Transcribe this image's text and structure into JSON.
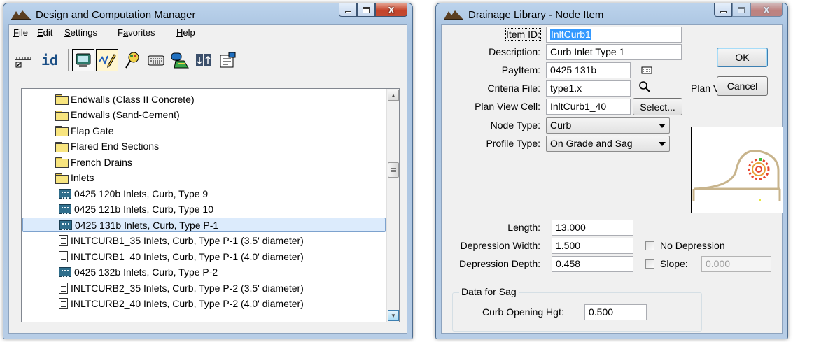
{
  "dcm": {
    "title": "Design and Computation Manager",
    "menu": [
      "File",
      "Edit",
      "Settings",
      "Favorites",
      "Help"
    ],
    "menu_accel": [
      "F",
      "E",
      "S",
      "a",
      "H"
    ],
    "toolbar_label": "id",
    "tree": [
      {
        "type": "folder",
        "label": "Endwalls (Class II Concrete)",
        "indent": 1
      },
      {
        "type": "folder",
        "label": "Endwalls (Sand-Cement)",
        "indent": 1
      },
      {
        "type": "folder",
        "label": "Flap Gate",
        "indent": 1
      },
      {
        "type": "folder",
        "label": "Flared End Sections",
        "indent": 1
      },
      {
        "type": "folder",
        "label": "French Drains",
        "indent": 1
      },
      {
        "type": "folder-open",
        "label": "Inlets",
        "indent": 1
      },
      {
        "type": "item",
        "label": "0425  120b Inlets, Curb, Type 9",
        "indent": 2
      },
      {
        "type": "item",
        "label": "0425  121b Inlets, Curb, Type 10",
        "indent": 2
      },
      {
        "type": "item",
        "label": "0425  131b Inlets, Curb, Type P-1",
        "indent": 2,
        "selected": true
      },
      {
        "type": "doc",
        "label": "INLTCURB1_35 Inlets, Curb, Type P-1 (3.5' diameter)",
        "indent": 2
      },
      {
        "type": "doc",
        "label": "INLTCURB1_40 Inlets, Curb, Type P-1 (4.0' diameter)",
        "indent": 2
      },
      {
        "type": "item",
        "label": "0425  132b Inlets, Curb, Type P-2",
        "indent": 2
      },
      {
        "type": "doc",
        "label": "INLTCURB2_35 Inlets, Curb, Type P-2 (3.5' diameter)",
        "indent": 2
      },
      {
        "type": "doc",
        "label": "INLTCURB2_40 Inlets, Curb, Type P-2 (4.0' diameter)",
        "indent": 2
      }
    ]
  },
  "node": {
    "title": "Drainage Library - Node Item",
    "item_id_label": "Item ID:",
    "item_id_value": "InltCurb1",
    "description_label": "Description:",
    "description_value": "Curb Inlet Type 1",
    "payitem_label": "PayItem:",
    "payitem_value": "0425  131b",
    "criteria_label": "Criteria File:",
    "criteria_value": "type1.x",
    "planview_label": "Plan View Cell:",
    "planview_value": "InltCurb1_40",
    "select_button": "Select...",
    "preview_label": "Plan View Cell:",
    "node_type_label": "Node Type:",
    "node_type_value": "Curb",
    "profile_type_label": "Profile Type:",
    "profile_type_value": "On Grade and Sag",
    "ok_button": "OK",
    "cancel_button": "Cancel",
    "length_label": "Length:",
    "length_value": "13.000",
    "dep_width_label": "Depression Width:",
    "dep_width_value": "1.500",
    "dep_depth_label": "Depression Depth:",
    "dep_depth_value": "0.458",
    "no_depression_label": "No Depression",
    "no_depression_checked": false,
    "slope_label": "Slope:",
    "slope_value": "0.000",
    "slope_checked": false,
    "sag_group_title": "Data for Sag",
    "curb_opening_label": "Curb Opening Hgt:",
    "curb_opening_value": "0.500"
  },
  "colors": {
    "title_bar": "#b9cfe8",
    "selection": "#dcebfc",
    "text_selection": "#3399ff",
    "cell_outline": "#c8b48c"
  }
}
